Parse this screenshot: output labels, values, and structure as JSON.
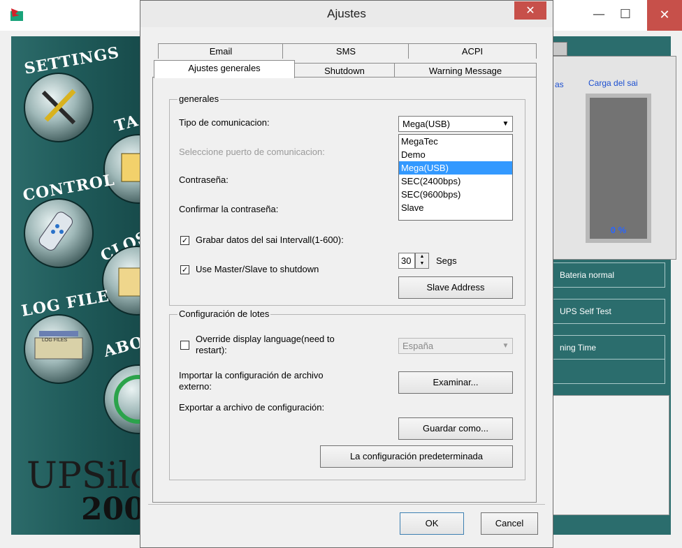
{
  "background_app": {
    "left_menu": [
      "SETTINGS",
      "TA",
      "CONTROL",
      "CLOS",
      "LOG FILE",
      "LOG FILES",
      "ABO"
    ],
    "brand": {
      "line1": "UPSilo",
      "line2": "200"
    },
    "right_panel": {
      "label_partial": "as",
      "label_load": "Carga del sai",
      "load_percent": "0 %",
      "status_battery": "Bateria normal",
      "status_selftest": "UPS Self Test",
      "status_time": "ning Time"
    },
    "window_buttons": {
      "minimize": "—",
      "maximize": "☐",
      "close": "✕"
    }
  },
  "dialog": {
    "title": "Ajustes",
    "close": "✕",
    "tabs_row1": [
      "Email",
      "SMS",
      "ACPI"
    ],
    "tabs_row2": [
      "Ajustes generales",
      "Shutdown",
      "Warning Message"
    ],
    "active_tab": "Ajustes generales",
    "generales": {
      "group_title": "generales",
      "tipo_label": "Tipo de comunicacion:",
      "tipo_value": "Mega(USB)",
      "options": [
        "MegaTec",
        "Demo",
        "Mega(USB)",
        "SEC(2400bps)",
        "SEC(9600bps)",
        "Slave"
      ],
      "selected_option": "Mega(USB)",
      "puerto_label": "Seleccione puerto de comunicacion:",
      "password_label": "Contraseña:",
      "confirm_label": "Confirmar la contraseña:",
      "grabar_label": "Grabar datos del sai Intervall(1-600):",
      "grabar_checked": true,
      "interval_value": "30",
      "interval_unit": "Segs",
      "master_slave_label": "Use Master/Slave to shutdown",
      "master_slave_checked": true,
      "slave_address_button": "Slave Address"
    },
    "lotes": {
      "group_title": "Configuración de lotes",
      "override_label_1": "Override display language(need to",
      "override_label_2": "restart):",
      "override_checked": false,
      "language_value": "España",
      "importar_label_1": "Importar la configuración de archivo",
      "importar_label_2": "externo:",
      "examinar_button": "Examinar...",
      "exportar_label": "Exportar a archivo de configuración:",
      "guardar_button": "Guardar como...",
      "default_button": "La configuración predeterminada"
    },
    "ok_button": "OK",
    "cancel_button": "Cancel"
  },
  "colors": {
    "teal_panel": "#2b6d6d",
    "selection": "#3399ff",
    "close_red": "#c7504a",
    "gauge_blue": "#2a66ff"
  }
}
